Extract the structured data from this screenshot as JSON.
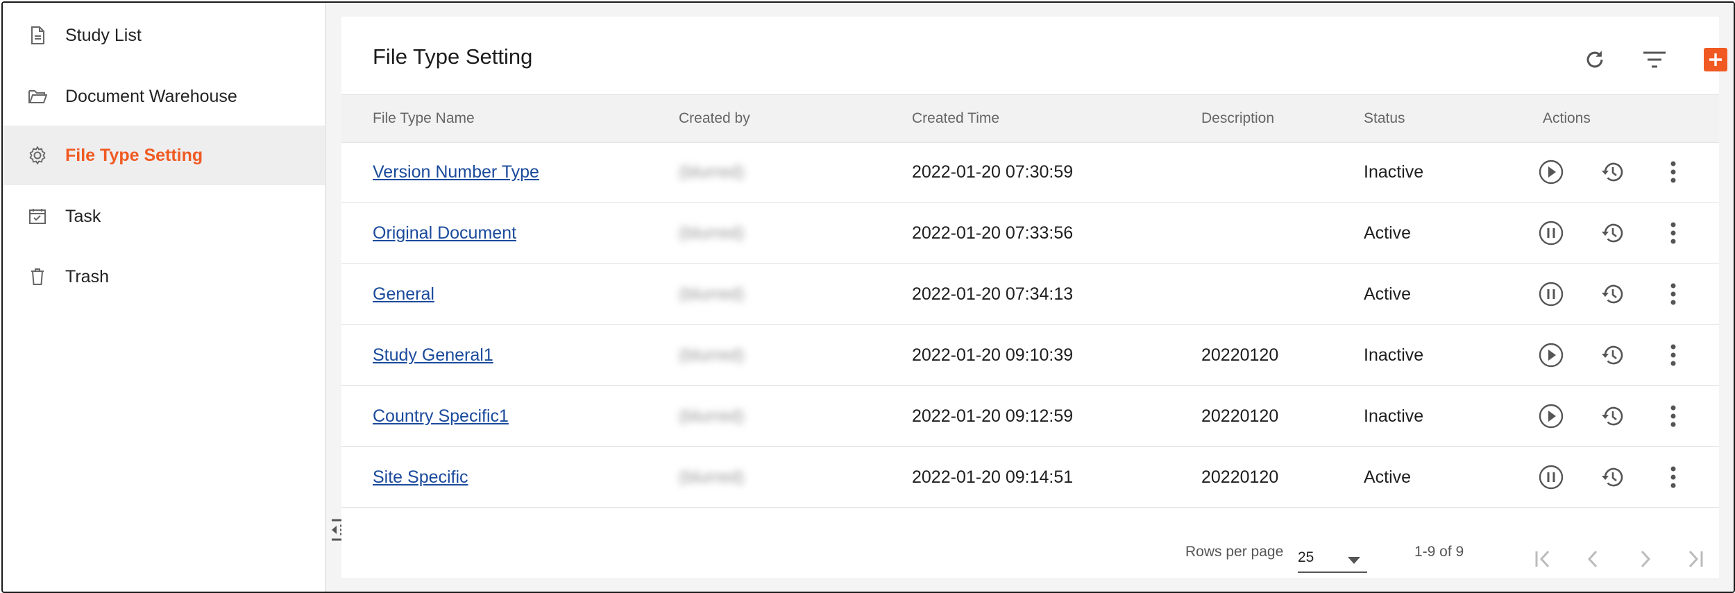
{
  "sidebar": {
    "items": [
      {
        "label": "Study List",
        "icon": "document-icon",
        "active": false
      },
      {
        "label": "Document Warehouse",
        "icon": "folder-open-icon",
        "active": false
      },
      {
        "label": "File Type Setting",
        "icon": "gear-icon",
        "active": true
      },
      {
        "label": "Task",
        "icon": "calendar-check-icon",
        "active": false
      },
      {
        "label": "Trash",
        "icon": "trash-icon",
        "active": false
      }
    ]
  },
  "header": {
    "title": "File Type Setting",
    "tools": [
      "refresh-icon",
      "filter-icon",
      "add-icon"
    ]
  },
  "table": {
    "columns": [
      "File Type Name",
      "Created by",
      "Created Time",
      "Description",
      "Status",
      "Actions"
    ],
    "rows": [
      {
        "name": "Version Number Type",
        "created_by": "(blurred)",
        "created_time": "2022-01-20 07:30:59",
        "description": "",
        "status": "Inactive",
        "action": "play"
      },
      {
        "name": "Original Document",
        "created_by": "(blurred)",
        "created_time": "2022-01-20 07:33:56",
        "description": "",
        "status": "Active",
        "action": "pause"
      },
      {
        "name": "General",
        "created_by": "(blurred)",
        "created_time": "2022-01-20 07:34:13",
        "description": "",
        "status": "Active",
        "action": "pause"
      },
      {
        "name": "Study General1",
        "created_by": "(blurred)",
        "created_time": "2022-01-20 09:10:39",
        "description": "20220120",
        "status": "Inactive",
        "action": "play"
      },
      {
        "name": "Country Specific1",
        "created_by": "(blurred)",
        "created_time": "2022-01-20 09:12:59",
        "description": "20220120",
        "status": "Inactive",
        "action": "play"
      },
      {
        "name": "Site Specific",
        "created_by": "(blurred)",
        "created_time": "2022-01-20 09:14:51",
        "description": "20220120",
        "status": "Active",
        "action": "pause"
      }
    ]
  },
  "footer": {
    "rows_per_page_label": "Rows per page",
    "rows_per_page_value": "25",
    "range_text": "1-9 of 9"
  },
  "colors": {
    "accent": "#f05a22",
    "link": "#1a4a9c",
    "icon": "#555555"
  }
}
